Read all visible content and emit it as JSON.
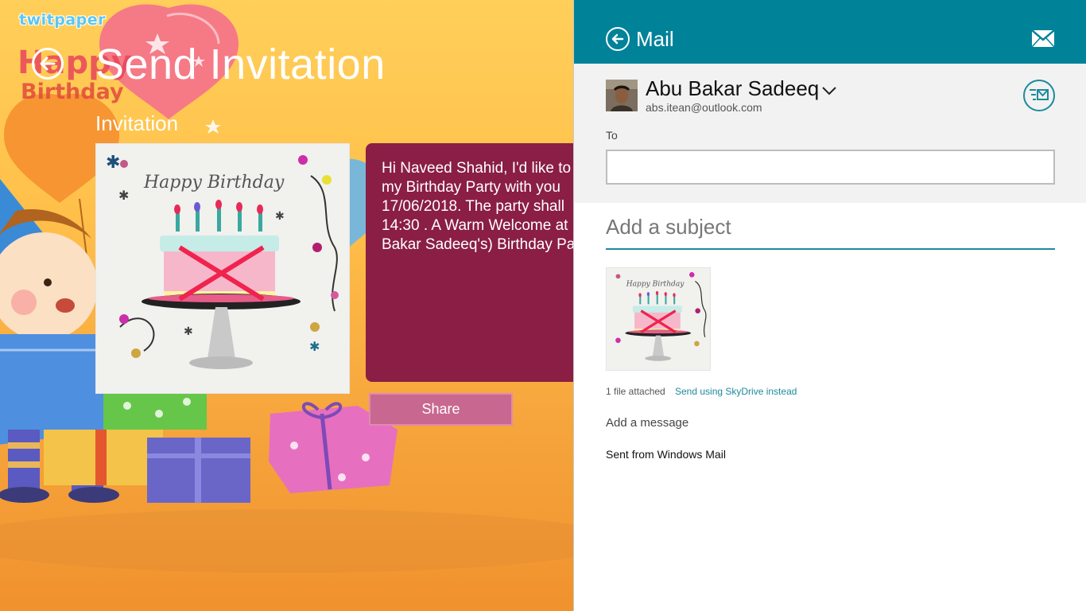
{
  "app": {
    "watermark_logo": "twitpaper",
    "art_text_happy": "Happy",
    "art_text_birthday": "Birthday",
    "page_title": "Send Invitation",
    "section_label": "Invitation",
    "card_caption": "Happy Birthday",
    "message_lines": [
      "Hi Naveed Shahid, I'd like to",
      "my Birthday Party with you",
      "17/06/2018. The party shall",
      "14:30 . A Warm Welcome at",
      "Bakar Sadeeq's) Birthday Pa"
    ],
    "share_label": "Share",
    "colors": {
      "message_bg": "#8a1e45",
      "share_bg": "#c8678f"
    }
  },
  "mail": {
    "title": "Mail",
    "header_color": "#008299",
    "from_name": "Abu Bakar Sadeeq",
    "from_email": "abs.itean@outlook.com",
    "to_label": "To",
    "to_value": "",
    "subject_placeholder": "Add a subject",
    "thumb_caption": "Happy Birthday",
    "attachment_count": "1 file attached",
    "skydrive_link": "Send using SkyDrive instead",
    "message_placeholder": "Add a message",
    "signature": "Sent from Windows Mail",
    "icons": {
      "back": "back-arrow-icon",
      "envelope": "envelope-icon",
      "send": "send-icon",
      "chevron": "chevron-down-icon"
    }
  }
}
